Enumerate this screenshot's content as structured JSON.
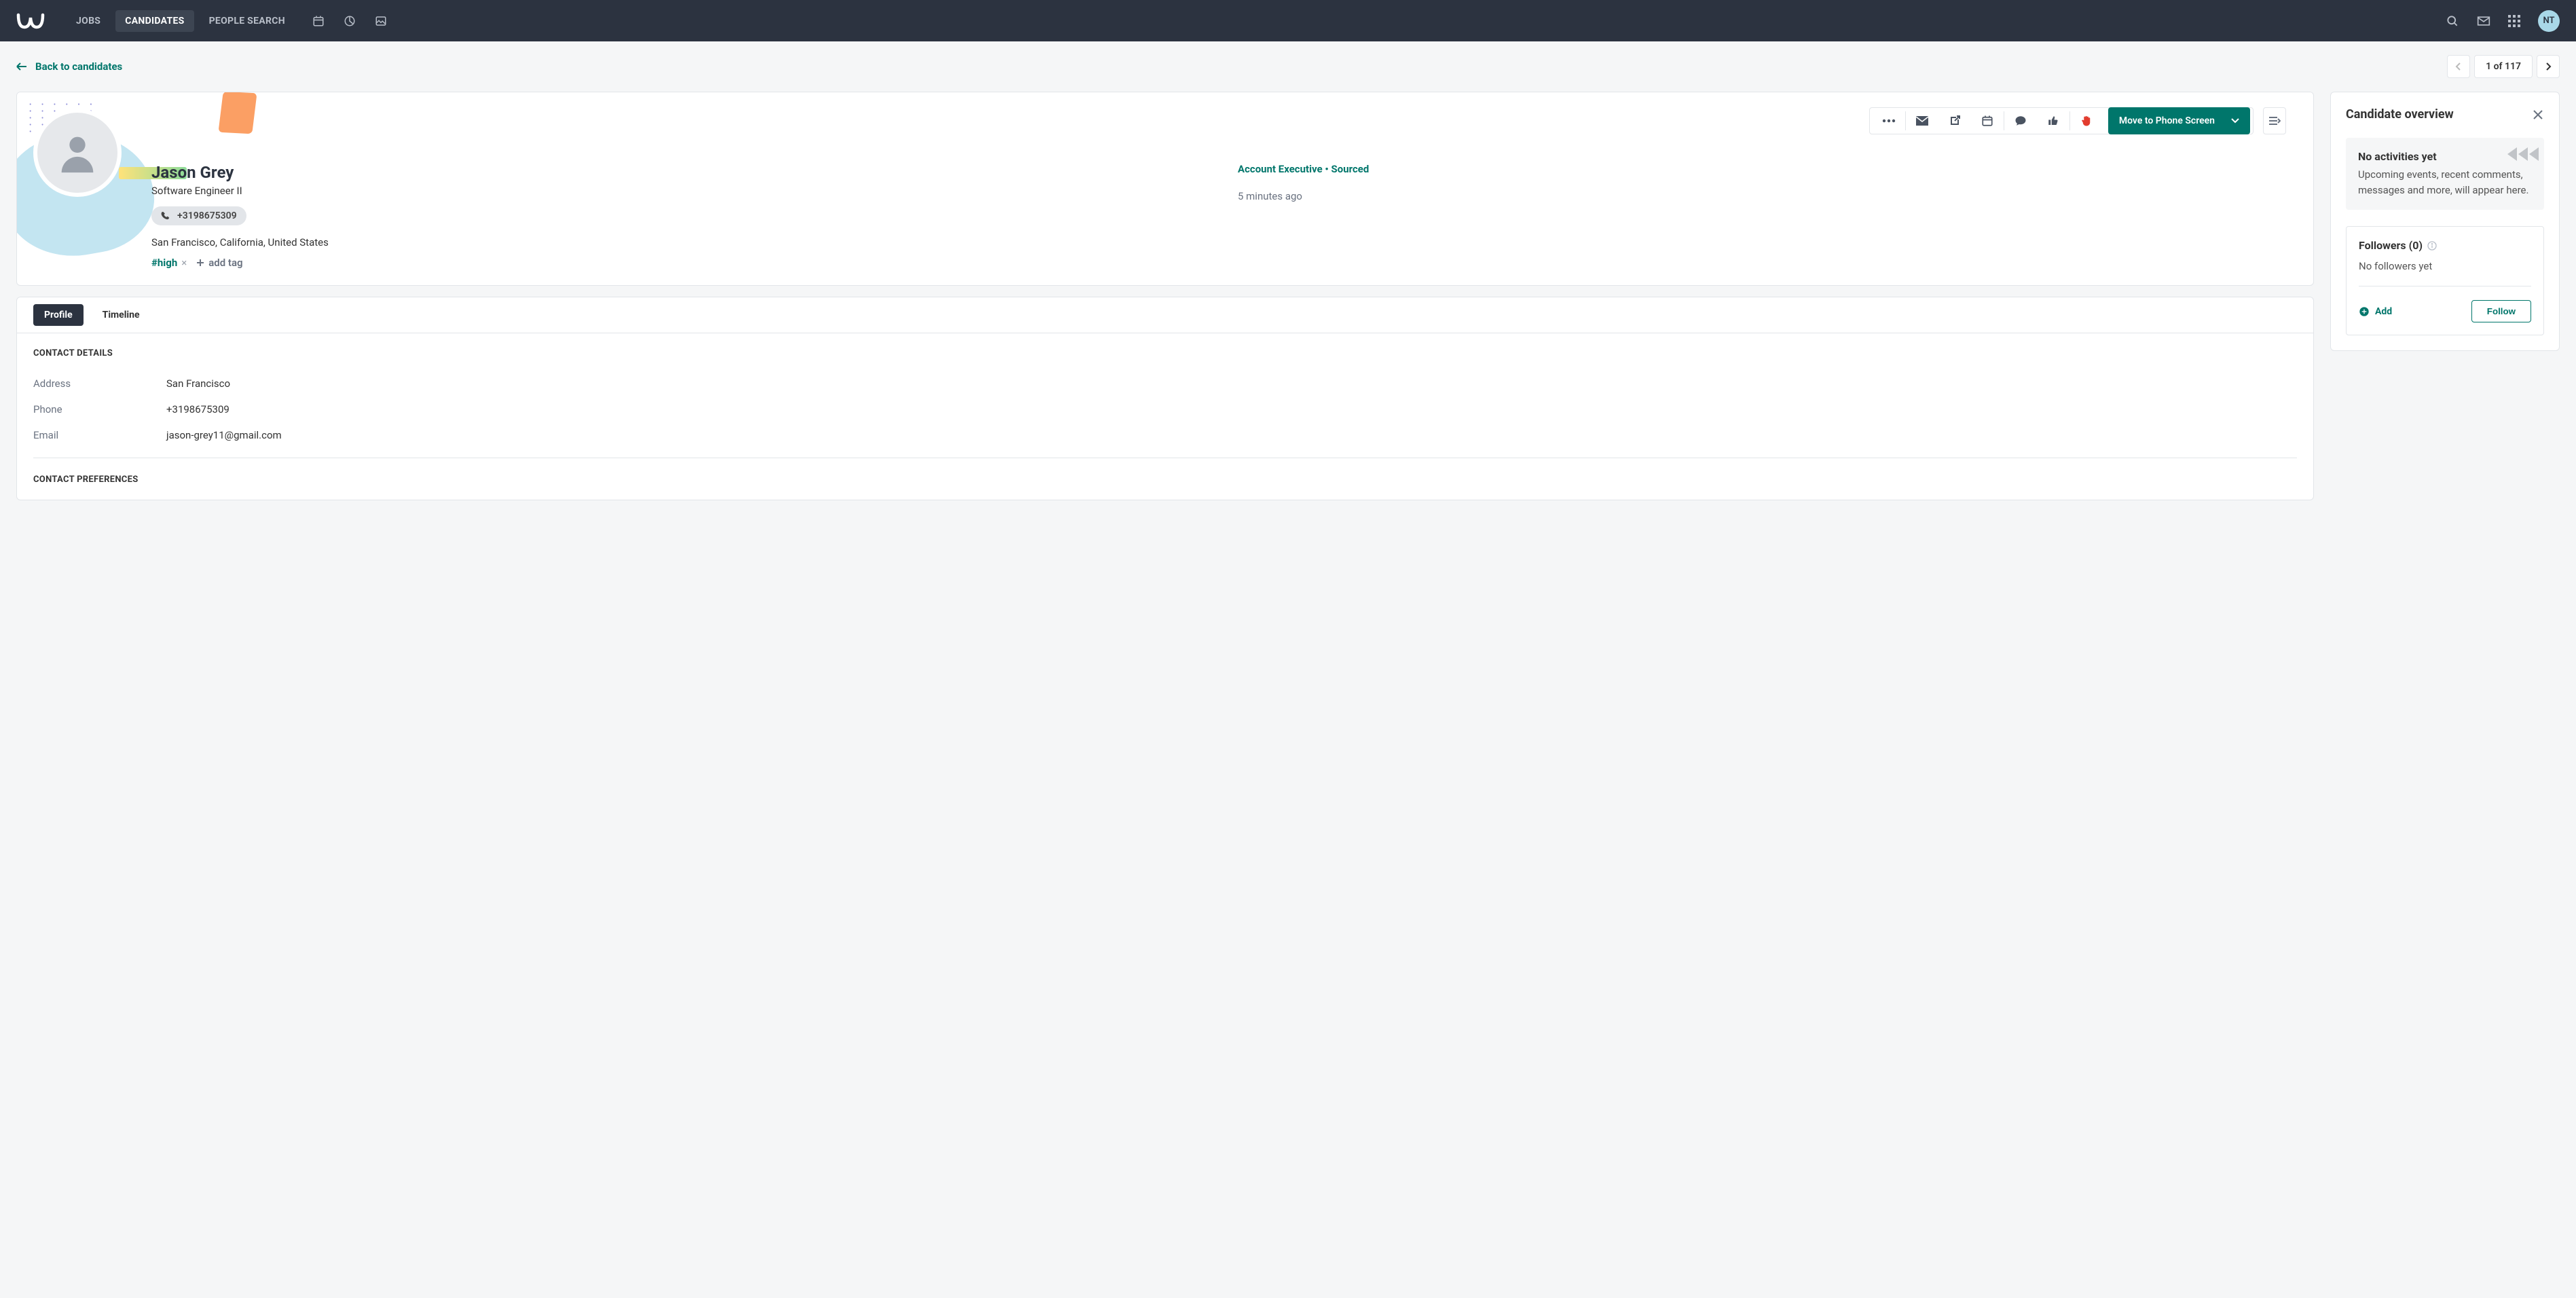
{
  "nav": {
    "items": [
      {
        "label": "JOBS"
      },
      {
        "label": "CANDIDATES"
      },
      {
        "label": "PEOPLE SEARCH"
      }
    ],
    "user_initials": "NT"
  },
  "subheader": {
    "back_label": "Back to candidates",
    "pager_text": "1 of 117"
  },
  "toolbar": {
    "move_label": "Move to Phone Screen"
  },
  "candidate": {
    "name": "Jason Grey",
    "title": "Software Engineer II",
    "phone": "+3198675309",
    "location": "San Francisco, California, United States",
    "tag": "#high",
    "add_tag_label": "add tag",
    "stage_line": "Account Executive • Sourced",
    "time_ago": "5 minutes ago"
  },
  "tabs": {
    "profile": "Profile",
    "timeline": "Timeline"
  },
  "contact": {
    "heading": "CONTACT DETAILS",
    "address_label": "Address",
    "address_value": "San Francisco",
    "phone_label": "Phone",
    "phone_value": "+3198675309",
    "email_label": "Email",
    "email_value": "jason-grey11@gmail.com",
    "prefs_heading": "CONTACT PREFERENCES"
  },
  "side": {
    "title": "Candidate overview",
    "activities_title": "No activities yet",
    "activities_body": "Upcoming events, recent comments, messages and more, will appear here.",
    "followers_title": "Followers (0)",
    "followers_body": "No followers yet",
    "add_label": "Add",
    "follow_label": "Follow"
  }
}
